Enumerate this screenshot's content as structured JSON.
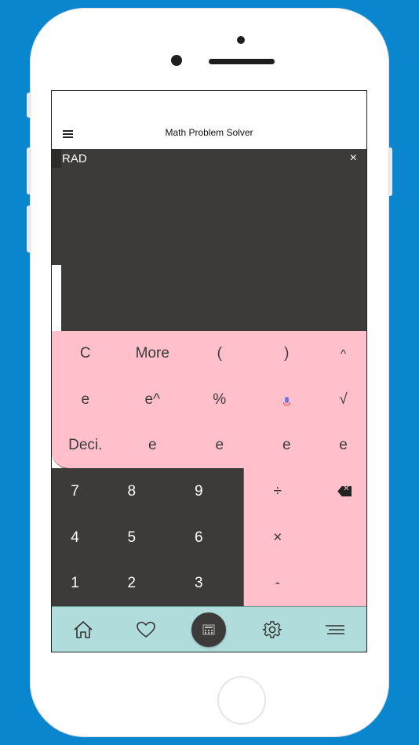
{
  "app": {
    "title": "Math Problem Solver"
  },
  "display": {
    "mode_label": "RAD",
    "close_label": "×"
  },
  "function_keys": {
    "row1": [
      "C",
      "More",
      "(",
      ")",
      "^"
    ],
    "row2": [
      "e",
      "e^",
      "%",
      "",
      "√"
    ],
    "row3": [
      "Deci.",
      "e",
      "e",
      "e",
      "e"
    ]
  },
  "number_keys": {
    "row1": [
      "7",
      "8",
      "9"
    ],
    "row2": [
      "4",
      "5",
      "6"
    ],
    "row3": [
      "1",
      "2",
      "3"
    ]
  },
  "operator_keys": {
    "row1": [
      "÷",
      ""
    ],
    "row2": [
      "×",
      ""
    ],
    "row3": [
      "-",
      ""
    ]
  },
  "icons": {
    "menu": "hamburger-icon",
    "mic": "microphone-icon",
    "backspace": "backspace-icon",
    "home": "home-icon",
    "favorites": "heart-icon",
    "calculator": "calculator-icon",
    "settings": "gear-icon",
    "more_menu": "menu-lines-icon"
  },
  "colors": {
    "background": "#0a86cf",
    "dark_panel": "#3c3b3a",
    "pink_panel": "#ffc0cb",
    "bottom_nav": "#b0dcdc"
  }
}
